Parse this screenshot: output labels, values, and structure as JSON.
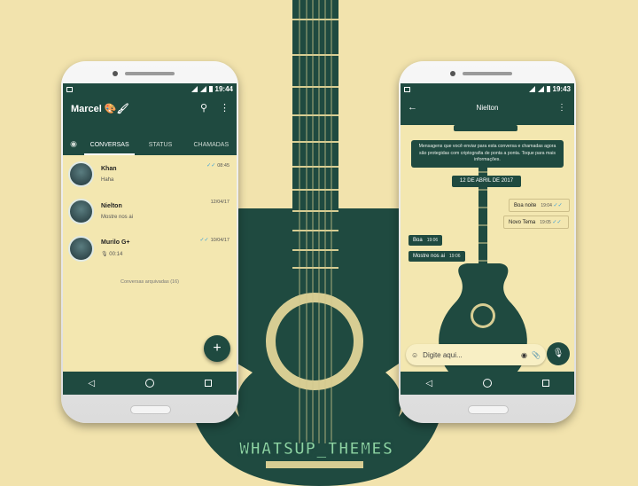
{
  "colors": {
    "primary": "#1f4a40",
    "background": "#f2e3ad",
    "screen": "#f3e7b0",
    "tick": "#3aa1d8"
  },
  "left_phone": {
    "status_time": "19:44",
    "title": "Marcel 🎨🖌",
    "tabs": [
      "CONVERSAS",
      "STATUS",
      "CHAMADAS"
    ],
    "chats": [
      {
        "name": "Khan",
        "message": "Haha",
        "time": "08:45",
        "ticks": "✓✓"
      },
      {
        "name": "Nielton",
        "message": "Mostre nos ai",
        "time": "12/04/17",
        "ticks": ""
      },
      {
        "name": "Murilo G+",
        "message": "00:14",
        "time": "10/04/17",
        "ticks": "✓✓"
      }
    ],
    "archived": "Conversas arquivadas (16)",
    "fab": "+"
  },
  "right_phone": {
    "status_time": "19:43",
    "contact": "Nielton",
    "top_chip": "",
    "notice": "Mensagens que você enviar para esta conversa e chamadas agora são protegidas com criptografia de ponta a ponta. Toque para mais informações.",
    "date": "12 DE ABRIL DE 2017",
    "messages": [
      {
        "text": "Boa noite",
        "time": "19:04",
        "dir": "out"
      },
      {
        "text": "Novo Tema",
        "time": "19:05",
        "dir": "out"
      },
      {
        "text": "Boa",
        "time": "19:06",
        "dir": "in"
      },
      {
        "text": "Mostre nos ai",
        "time": "19:06",
        "dir": "in"
      }
    ],
    "input_placeholder": "Digite aqui..."
  },
  "watermark": "WHATSUP_THEMES",
  "icons": [
    "search-icon",
    "more-icon",
    "camera-icon",
    "back-icon",
    "emoji-icon",
    "attach-icon",
    "mic-icon",
    "nav-back-icon",
    "nav-home-icon",
    "nav-recents-icon"
  ]
}
